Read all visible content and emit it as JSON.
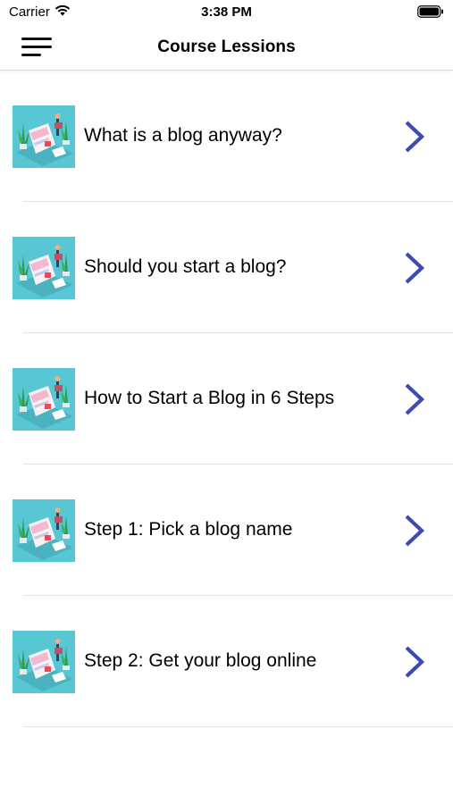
{
  "status_bar": {
    "carrier": "Carrier",
    "time": "3:38 PM",
    "wifi_icon": "wifi-icon",
    "battery_icon": "battery-icon"
  },
  "nav": {
    "title": "Course Lessions",
    "menu_icon": "hamburger-menu-icon"
  },
  "colors": {
    "chevron": "#3c4bb0",
    "thumb_bg": "#58c7d3",
    "divider": "#e3e3e3"
  },
  "lessons": [
    {
      "title": "What is a blog anyway?",
      "thumb_icon": "blog-illustration-icon",
      "chevron_icon": "chevron-right-icon"
    },
    {
      "title": "Should you start a blog?",
      "thumb_icon": "blog-illustration-icon",
      "chevron_icon": "chevron-right-icon"
    },
    {
      "title": "How to Start a Blog in 6 Steps",
      "thumb_icon": "blog-illustration-icon",
      "chevron_icon": "chevron-right-icon"
    },
    {
      "title": "Step 1: Pick a blog name",
      "thumb_icon": "blog-illustration-icon",
      "chevron_icon": "chevron-right-icon"
    },
    {
      "title": "Step 2: Get your blog online",
      "thumb_icon": "blog-illustration-icon",
      "chevron_icon": "chevron-right-icon"
    }
  ]
}
